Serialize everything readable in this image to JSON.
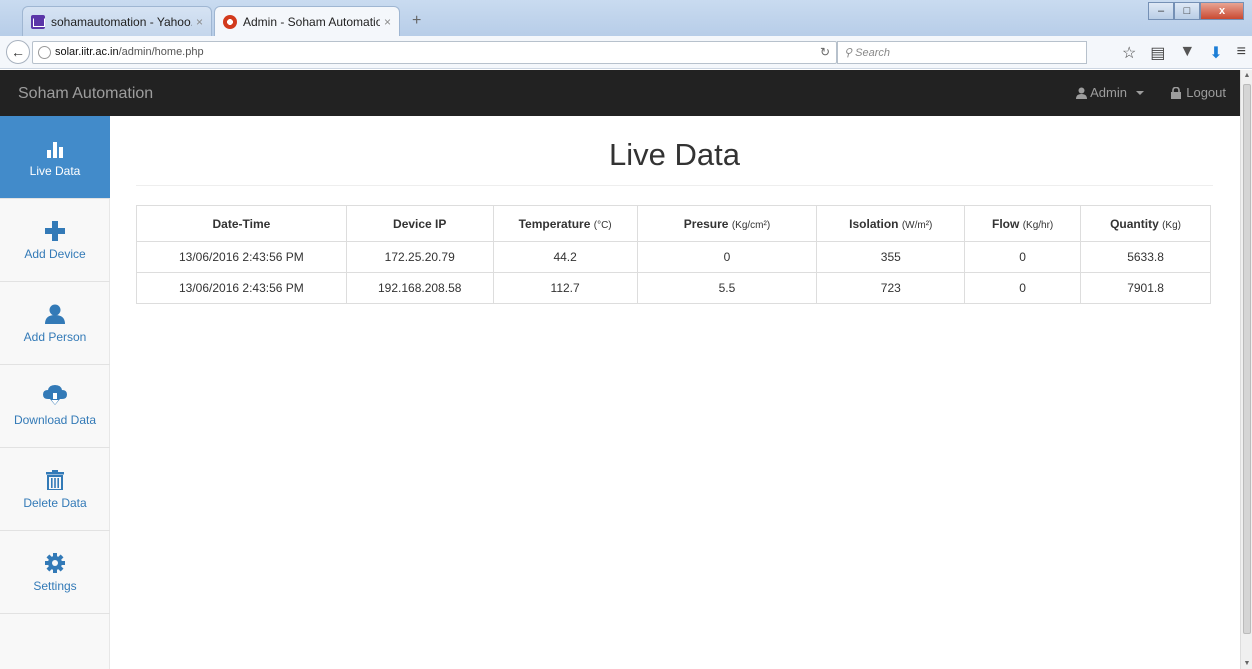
{
  "browser": {
    "tabs": [
      {
        "label": "sohamautomation - Yahoo...",
        "close": "×"
      },
      {
        "label": "Admin - Soham Automation",
        "close": "×"
      }
    ],
    "new_tab": "+",
    "url_host": "solar.iitr.ac.in",
    "url_path": "/admin/home.php",
    "search_placeholder": "Search",
    "window_buttons": {
      "minimize": "–",
      "maximize": "□",
      "close": "x"
    }
  },
  "appbar": {
    "brand": "Soham Automation",
    "user": "Admin",
    "logout": "Logout"
  },
  "sidebar": {
    "items": [
      {
        "label": "Live Data",
        "icon": "bar-chart-icon"
      },
      {
        "label": "Add Device",
        "icon": "plus-icon"
      },
      {
        "label": "Add Person",
        "icon": "user-icon"
      },
      {
        "label": "Download Data",
        "icon": "cloud-download-icon"
      },
      {
        "label": "Delete Data",
        "icon": "trash-icon"
      },
      {
        "label": "Settings",
        "icon": "gear-icon"
      }
    ]
  },
  "main": {
    "title": "Live Data",
    "columns": [
      {
        "name": "Date-Time",
        "unit": ""
      },
      {
        "name": "Device IP",
        "unit": ""
      },
      {
        "name": "Temperature",
        "unit": "(°C)"
      },
      {
        "name": "Presure",
        "unit": "(Kg/cm²)"
      },
      {
        "name": "Isolation",
        "unit": "(W/m²)"
      },
      {
        "name": "Flow",
        "unit": "(Kg/hr)"
      },
      {
        "name": "Quantity",
        "unit": "(Kg)"
      }
    ],
    "rows": [
      [
        "13/06/2016 2:43:56 PM",
        "172.25.20.79",
        "44.2",
        "0",
        "355",
        "0",
        "5633.8"
      ],
      [
        "13/06/2016 2:43:56 PM",
        "192.168.208.58",
        "112.7",
        "5.5",
        "723",
        "0",
        "7901.8"
      ]
    ]
  },
  "colors": {
    "appbar_bg": "#222222",
    "sidebar_active": "#428bca",
    "link": "#337ab7"
  }
}
